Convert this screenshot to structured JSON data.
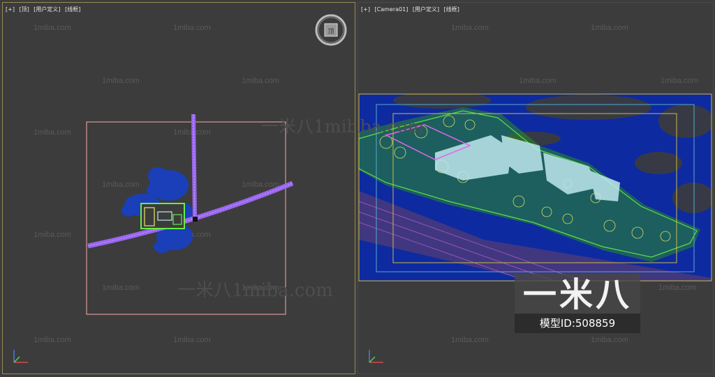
{
  "viewports": {
    "top": {
      "labels": [
        "[+]",
        "[顶]",
        "[用户定义]",
        "[线框]"
      ]
    },
    "camera": {
      "labels": [
        "[+]",
        "[Camera01]",
        "[用户定义]",
        "[线框]"
      ]
    }
  },
  "viewcube": {
    "face_label": "顶"
  },
  "watermarks": {
    "small": "1miba.com",
    "big": "一米八1miba.com"
  },
  "badge": {
    "logo_text": "一米八",
    "model_id": "模型ID:508859"
  },
  "colors": {
    "top_viewport_border": "#9a8a55",
    "road_purple": "#9966ee",
    "tree_blue": "#1a3fb8",
    "frame_pink": "#d89a9a",
    "building_cyan": "#bfe8ee",
    "vegetation_green": "#66ee44",
    "tree_yellow": "#e8e866",
    "safe_frame_yellow": "#ccbb44",
    "safe_frame_cyan": "#55aacc"
  },
  "icons": [
    "viewcube-icon",
    "axis-tripod-icon"
  ]
}
